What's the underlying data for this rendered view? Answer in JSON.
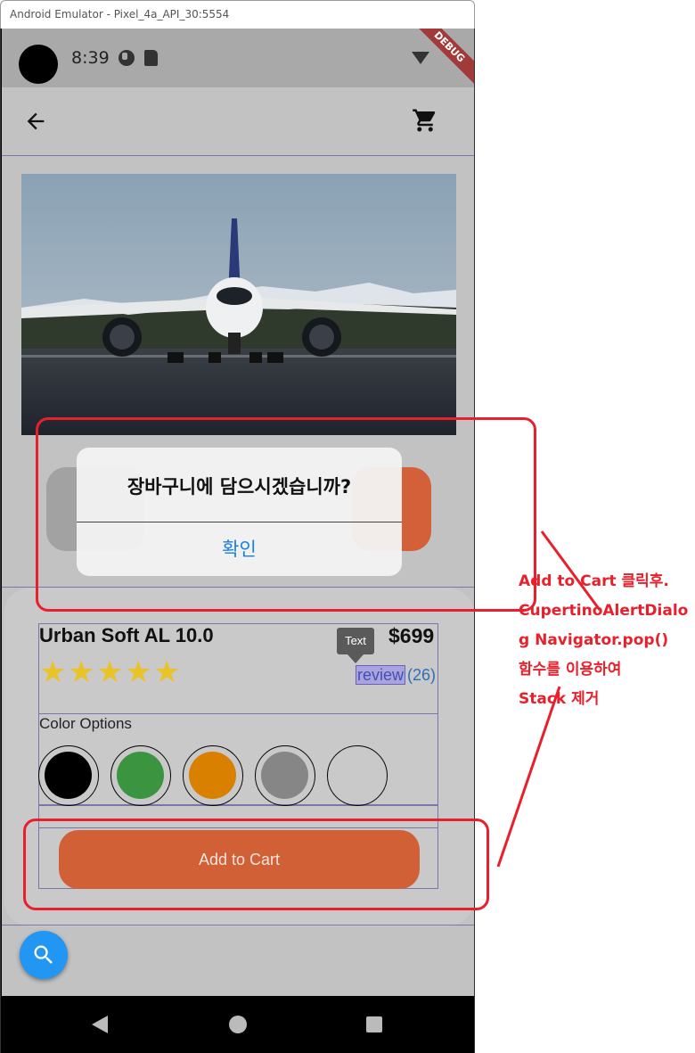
{
  "window": {
    "title": "Android Emulator - Pixel_4a_API_30:5554"
  },
  "status_bar": {
    "time": "8:39",
    "debug_banner": "DEBUG"
  },
  "app_bar": {
    "back_icon": "arrow-back-icon",
    "cart_icon": "shopping-cart-icon"
  },
  "dialog": {
    "title": "장바구니에 담으시겠습니까?",
    "confirm_label": "확인"
  },
  "product": {
    "name": "Urban Soft AL 10.0",
    "price": "$699",
    "rating_stars": 5,
    "tooltip": "Text",
    "review_label": "review",
    "review_count": "(26)",
    "color_options_label": "Color Options",
    "colors": [
      "#000000",
      "#3b9540",
      "#d98000",
      "#868686",
      "#c9c9c9"
    ],
    "add_to_cart_label": "Add to Cart"
  },
  "fab": {
    "icon": "search-icon"
  },
  "annotation": {
    "lines": [
      "Add to Cart 클릭후.",
      "CupertinoAlertDialo",
      "g Navigator.pop()",
      "함수를 이용하여",
      "Stack 제거"
    ],
    "color": "#e8202c"
  },
  "colors": {
    "accent": "#d26037",
    "dialog_action": "#1a7fe0",
    "fab": "#2196f3",
    "star": "#e8c42a"
  }
}
